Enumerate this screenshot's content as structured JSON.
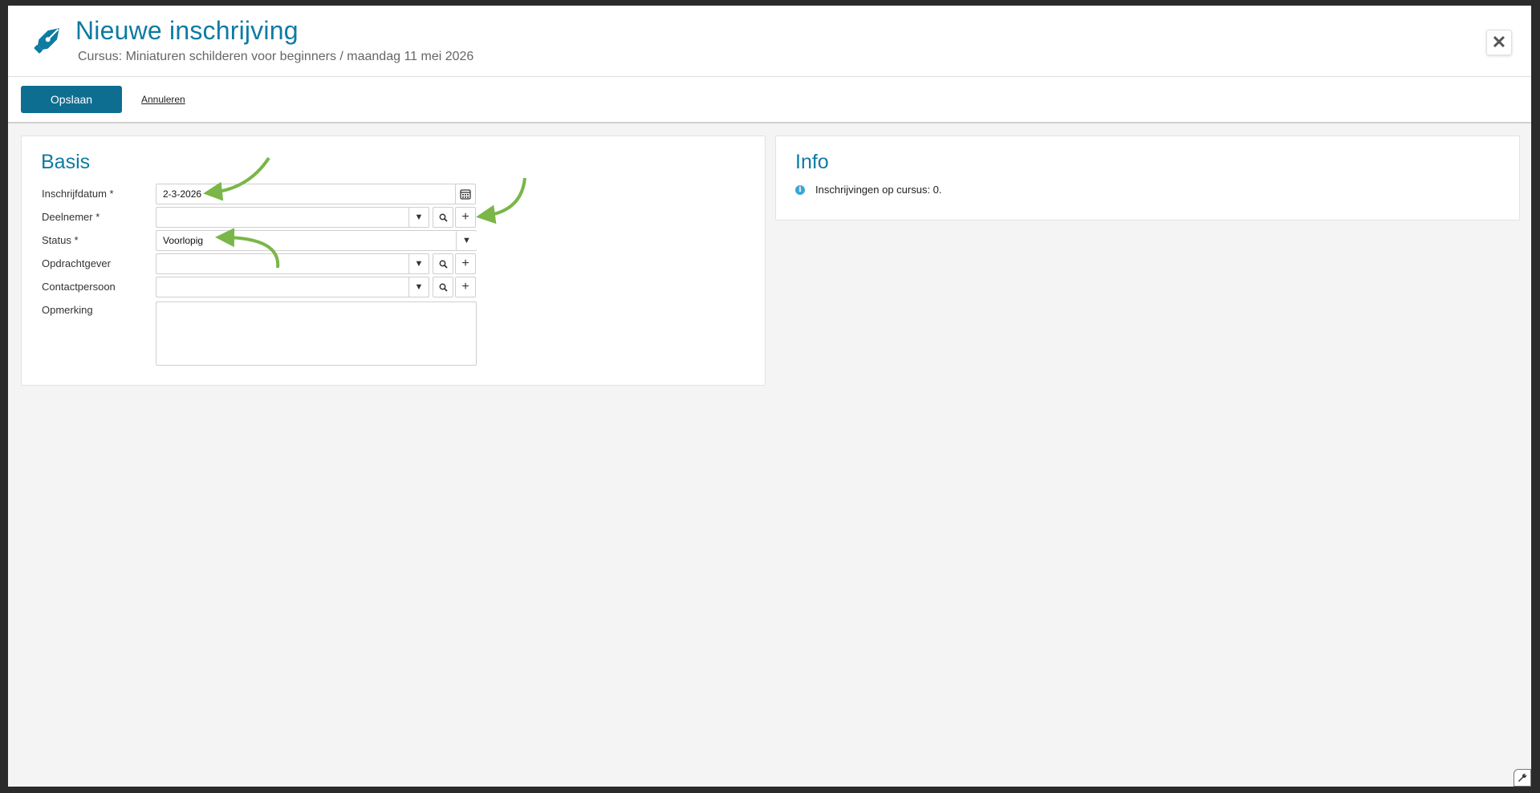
{
  "header": {
    "title": "Nieuwe inschrijving",
    "subtitle": "Cursus: Miniaturen schilderen voor beginners / maandag 11 mei 2026",
    "icon": "fountain-pen-icon",
    "close_icon": "close-icon"
  },
  "toolbar": {
    "save_label": "Opslaan",
    "cancel_label": "Annuleren"
  },
  "basis": {
    "title": "Basis",
    "fields": {
      "inschrijfdatum": {
        "label": "Inschrijfdatum *",
        "value": "2-3-2026"
      },
      "deelnemer": {
        "label": "Deelnemer *",
        "value": ""
      },
      "status": {
        "label": "Status *",
        "value": "Voorlopig"
      },
      "opdrachtgever": {
        "label": "Opdrachtgever",
        "value": ""
      },
      "contactpersoon": {
        "label": "Contactpersoon",
        "value": ""
      },
      "opmerking": {
        "label": "Opmerking",
        "value": ""
      }
    }
  },
  "info": {
    "title": "Info",
    "message": "Inschrijvingen op cursus: 0."
  },
  "colors": {
    "accent": "#0e7ba3",
    "button": "#0e6e92",
    "annotation_arrow": "#7ab648",
    "info_dot": "#3aa6d4"
  }
}
